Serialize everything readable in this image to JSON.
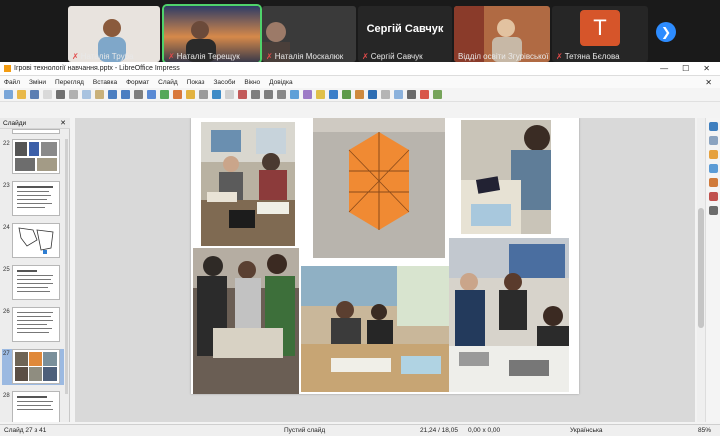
{
  "meeting": {
    "participants": [
      {
        "name": "Наталія Труба"
      },
      {
        "name": "Наталія Терещук"
      },
      {
        "name": "Наталія Москалюк"
      },
      {
        "name": "Сергій Савчук",
        "display": "Сергій Савчук"
      },
      {
        "name": "Відділ освіти Згурівської ..."
      },
      {
        "name": "Тетяна Бєлова",
        "initial": "T"
      }
    ],
    "next_icon": "chevron-right-icon"
  },
  "window": {
    "title": "Ігрові технології навчання.pptx - LibreOffice Impress",
    "controls": [
      "—",
      "☐",
      "✕"
    ]
  },
  "menu": [
    "Файл",
    "Зміни",
    "Перегляд",
    "Вставка",
    "Формат",
    "Слайд",
    "Показ",
    "Засоби",
    "Вікно",
    "Довідка"
  ],
  "sidebar": {
    "title": "Слайди",
    "slides": [
      {
        "num": "22"
      },
      {
        "num": "23"
      },
      {
        "num": "24"
      },
      {
        "num": "25"
      },
      {
        "num": "26"
      },
      {
        "num": "27"
      },
      {
        "num": "28"
      }
    ],
    "selected": "27"
  },
  "status": {
    "slide": "Слайд 27 з 41",
    "layout": "Пустий слайд",
    "position": "21,24 / 18,05",
    "size": "0,00 x 0,00",
    "language": "Українська",
    "zoom": "85%"
  },
  "colors": {
    "accent": "#2d8cff",
    "active_speaker": "#4fd36b",
    "selected_slide": "#9bb9e1",
    "orange_shape": "#f08a33"
  }
}
